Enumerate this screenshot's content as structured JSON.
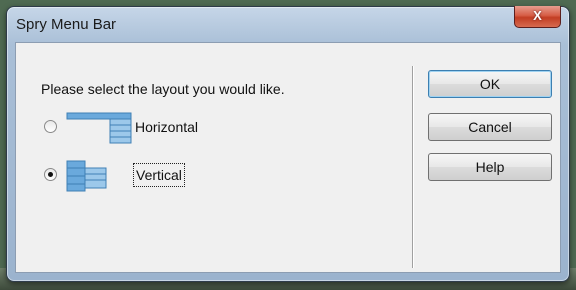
{
  "window": {
    "title": "Spry Menu Bar",
    "close_glyph": "X"
  },
  "dialog": {
    "prompt": "Please select the layout you would like.",
    "options": [
      {
        "label": "Horizontal",
        "selected": false,
        "icon": "horizontal-layout-icon"
      },
      {
        "label": "Vertical",
        "selected": true,
        "icon": "vertical-layout-icon"
      }
    ]
  },
  "buttons": {
    "ok": "OK",
    "cancel": "Cancel",
    "help": "Help"
  },
  "colors": {
    "icon_blue": "#6aa9dc",
    "close_red": "#c23d23",
    "default_button_border": "#3c7fb1"
  }
}
